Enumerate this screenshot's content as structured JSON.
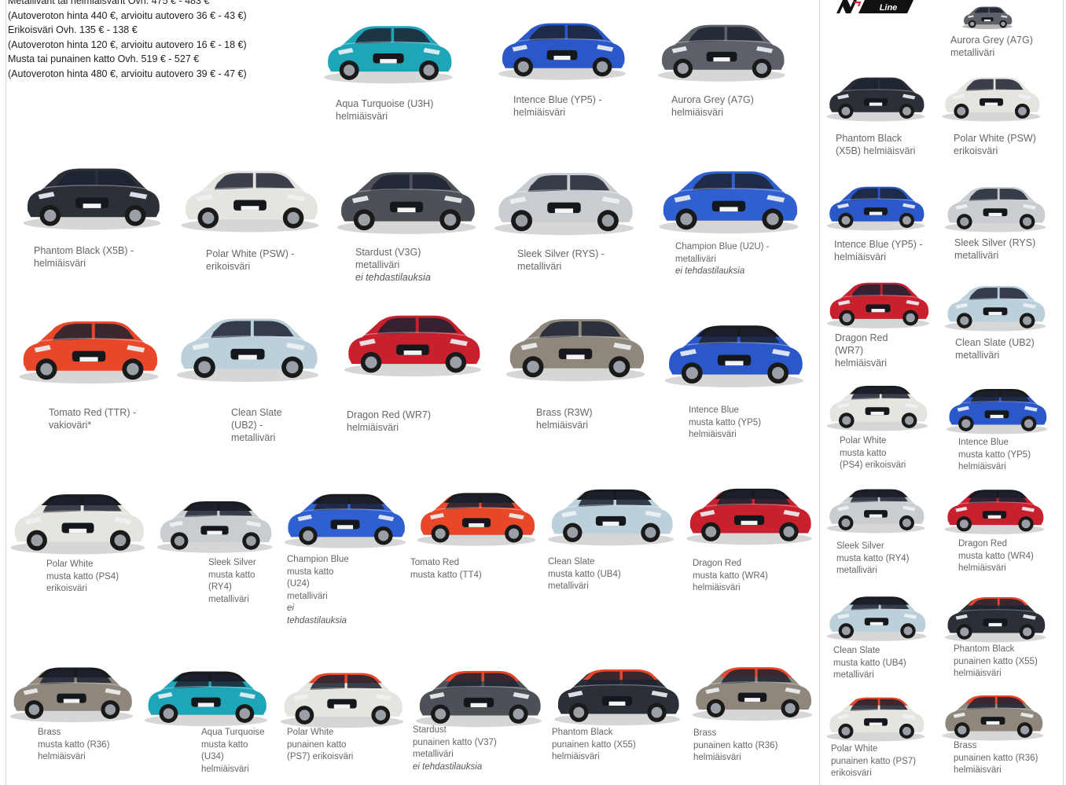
{
  "price_lines": [
    "Metallivärit tai helmiäisvärit  Ovh. 475 € - 483 €",
    "(Autoveroton hinta 440 €, arvioitu autovero 36 € - 43 €)",
    "Erikoisväri  Ovh. 135 € - 138 €",
    "(Autoveroton hinta 120 €, arvioitu autovero 16 € - 18 €)",
    "Musta tai punainen katto  Ovh. 519 € - 527 €",
    "(Autoveroton hinta 480 €, arvioitu autovero 39 € - 47 €)"
  ],
  "nline_logo_text": "Line",
  "colors": {
    "body_text": "#444444",
    "caption_text": "#666666",
    "divider": "#d8d8d8"
  },
  "cars": [
    {
      "caption": "Aqua Turquoise (U3H)\nhelmiäisväri",
      "body": "#1ea5b8",
      "roof": null
    },
    {
      "caption": "Intence Blue (YP5) -\nhelmiäisväri",
      "body": "#2a58c9",
      "roof": null
    },
    {
      "caption": "Aurora Grey (A7G)\nhelmiäisväri",
      "body": "#5d6167",
      "roof": null
    },
    {
      "caption": "Phantom Black (X5B) -\nhelmiäisväri",
      "body": "#2b2f36",
      "roof": null
    },
    {
      "caption": "Polar White (PSW) -\nerikoisväri",
      "body": "#e6e4df",
      "roof": null
    },
    {
      "caption": "Stardust (V3G)\nmetalliväri",
      "note": "ei tehdastilauksia",
      "body": "#4d5056",
      "roof": null
    },
    {
      "caption": "Sleek Silver (RYS) -\nmetalliväri",
      "body": "#c9ccd0",
      "roof": null
    },
    {
      "caption": "Champion Blue (U2U) -\nmetalliväri",
      "note": "ei tehdastilauksia",
      "body": "#2f5fd0",
      "roof": null
    },
    {
      "caption": "Tomato Red (TTR) -\nvakioväri*",
      "body": "#e8472a",
      "roof": null
    },
    {
      "caption": "Clean Slate\n(UB2) -\nmetalliväri",
      "body": "#bcd0dc",
      "roof": null
    },
    {
      "caption": "Dragon Red (WR7)\nhelmiäisväri",
      "body": "#c9202e",
      "roof": null
    },
    {
      "caption": "Brass (R3W)\nhelmiäisväri",
      "body": "#8f877c",
      "roof": null
    },
    {
      "caption": "Intence Blue\nmusta katto  (YP5)\nhelmiäisväri",
      "body": "#2a58c9",
      "roof": "#1a1a1a"
    },
    {
      "caption": "Polar White\nmusta katto (PS4)\nerikoisväri",
      "body": "#e6e4df",
      "roof": "#1a1a1a"
    },
    {
      "caption": "Sleek Silver\nmusta katto\n(RY4)\nmetalliväri",
      "body": "#c9ccd0",
      "roof": "#1a1a1a"
    },
    {
      "caption": "Champion Blue\nmusta katto\n(U24)\nmetalliväri",
      "note": "ei\ntehdastilauksia",
      "body": "#2f5fd0",
      "roof": "#1a1a1a"
    },
    {
      "caption": "Tomato Red\nmusta katto (TT4)",
      "body": "#e8472a",
      "roof": "#1a1a1a"
    },
    {
      "caption": "Clean Slate\nmusta katto  (UB4)\nmetalliväri",
      "body": "#bcd0dc",
      "roof": "#1a1a1a"
    },
    {
      "caption": "Dragon Red\nmusta katto (WR4)\nhelmiäisväri",
      "body": "#c9202e",
      "roof": "#1a1a1a"
    },
    {
      "caption": "Brass\nmusta katto (R36)\nhelmiäisväri",
      "body": "#8f877c",
      "roof": "#1a1a1a"
    },
    {
      "caption": "Aqua Turquoise\nmusta katto\n(U34)\nhelmiäisväri",
      "body": "#1ea5b8",
      "roof": "#1a1a1a"
    },
    {
      "caption": "Polar White\npunainen katto\n(PS7) erikoisväri",
      "body": "#e6e4df",
      "roof": "#e8472a"
    },
    {
      "caption": "Stardust\npunainen katto (V37)\nmetalliväri",
      "note": "ei tehdastilauksia",
      "body": "#4d5056",
      "roof": "#e8472a"
    },
    {
      "caption": "Phantom Black\npunainen katto (X55)\nhelmiäisväri",
      "body": "#2b2f36",
      "roof": "#e8472a"
    },
    {
      "caption": "Brass\npunainen katto (R36)\nhelmiäisväri",
      "body": "#8f877c",
      "roof": "#e8472a"
    },
    {
      "caption": "",
      "body": "#5d6167",
      "roof": null
    },
    {
      "caption": "Aurora Grey (A7G)\nmetalliväri",
      "body": "#5d6167",
      "roof": null
    },
    {
      "caption": "Phantom Black\n(X5B) helmiäisväri",
      "body": "#2b2f36",
      "roof": null
    },
    {
      "caption": "Polar White (PSW)\nerikoisväri",
      "body": "#e6e4df",
      "roof": null
    },
    {
      "caption": "Intence Blue (YP5) -\nhelmiäisväri",
      "body": "#2a58c9",
      "roof": null
    },
    {
      "caption": "Sleek Silver (RYS)\nmetalliväri",
      "body": "#c9ccd0",
      "roof": null
    },
    {
      "caption": "Dragon Red\n(WR7)\nhelmiäisväri",
      "body": "#c9202e",
      "roof": null
    },
    {
      "caption": "Clean Slate (UB2)\nmetalliväri",
      "body": "#bcd0dc",
      "roof": null
    },
    {
      "caption": "Polar White\nmusta katto\n(PS4) erikoisväri",
      "body": "#e6e4df",
      "roof": "#1a1a1a"
    },
    {
      "caption": "Intence Blue\nmusta katto  (YP5)\nhelmiäisväri",
      "body": "#2a58c9",
      "roof": "#1a1a1a"
    },
    {
      "caption": "Sleek Silver\nmusta katto (RY4)\nmetalliväri",
      "body": "#c9ccd0",
      "roof": "#1a1a1a"
    },
    {
      "caption": "Dragon Red\nmusta katto (WR4)\nhelmiäisväri",
      "body": "#c9202e",
      "roof": "#1a1a1a"
    },
    {
      "caption": "Clean Slate\nmusta katto  (UB4)\nmetalliväri",
      "body": "#bcd0dc",
      "roof": "#1a1a1a"
    },
    {
      "caption": "Phantom Black\npunainen katto (X55)\nhelmiäisväri",
      "body": "#2b2f36",
      "roof": "#e8472a"
    },
    {
      "caption": "Polar White\npunainen katto (PS7)\nerikoisväri",
      "body": "#e6e4df",
      "roof": "#e8472a"
    },
    {
      "caption": "Brass\npunainen katto (R36)\nhelmiäisväri",
      "body": "#8f877c",
      "roof": "#e8472a"
    }
  ]
}
